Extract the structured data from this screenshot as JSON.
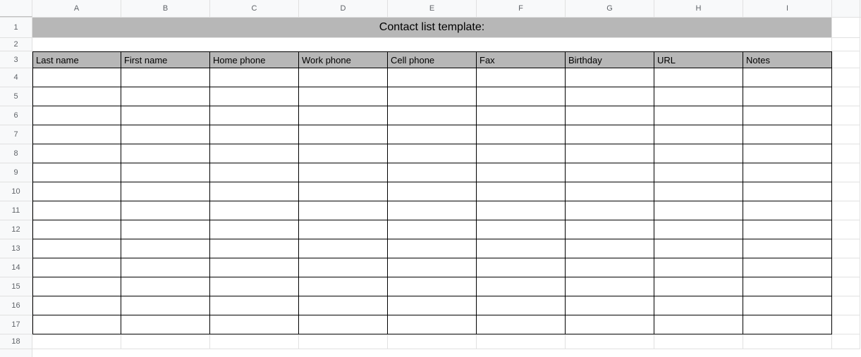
{
  "columns": [
    "A",
    "B",
    "C",
    "D",
    "E",
    "F",
    "G",
    "H",
    "I"
  ],
  "rows": [
    "1",
    "2",
    "3",
    "4",
    "5",
    "6",
    "7",
    "8",
    "9",
    "10",
    "11",
    "12",
    "13",
    "14",
    "15",
    "16",
    "17",
    "18"
  ],
  "title": "Contact list template:",
  "headers": {
    "c0": "Last name",
    "c1": "First name",
    "c2": "Home phone",
    "c3": "Work phone",
    "c4": "Cell phone",
    "c5": "Fax",
    "c6": "Birthday",
    "c7": "URL",
    "c8": "Notes"
  }
}
